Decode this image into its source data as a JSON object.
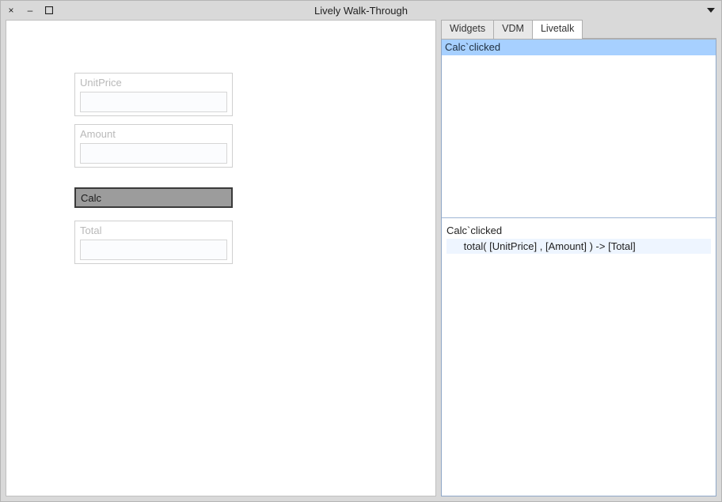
{
  "window": {
    "title": "Lively Walk-Through"
  },
  "canvas": {
    "widgets": {
      "unitPrice": {
        "label": "UnitPrice",
        "value": ""
      },
      "amount": {
        "label": "Amount",
        "value": ""
      },
      "calc": {
        "label": "Calc"
      },
      "total": {
        "label": "Total",
        "value": ""
      }
    }
  },
  "sidepanel": {
    "tabs": [
      {
        "label": "Widgets",
        "active": false
      },
      {
        "label": "VDM",
        "active": false
      },
      {
        "label": "Livetalk",
        "active": true
      }
    ],
    "events": {
      "selected": "Calc`clicked"
    },
    "editor": {
      "line1": "Calc`clicked",
      "line2": "      total( [UnitPrice] , [Amount] ) -> [Total]"
    }
  }
}
